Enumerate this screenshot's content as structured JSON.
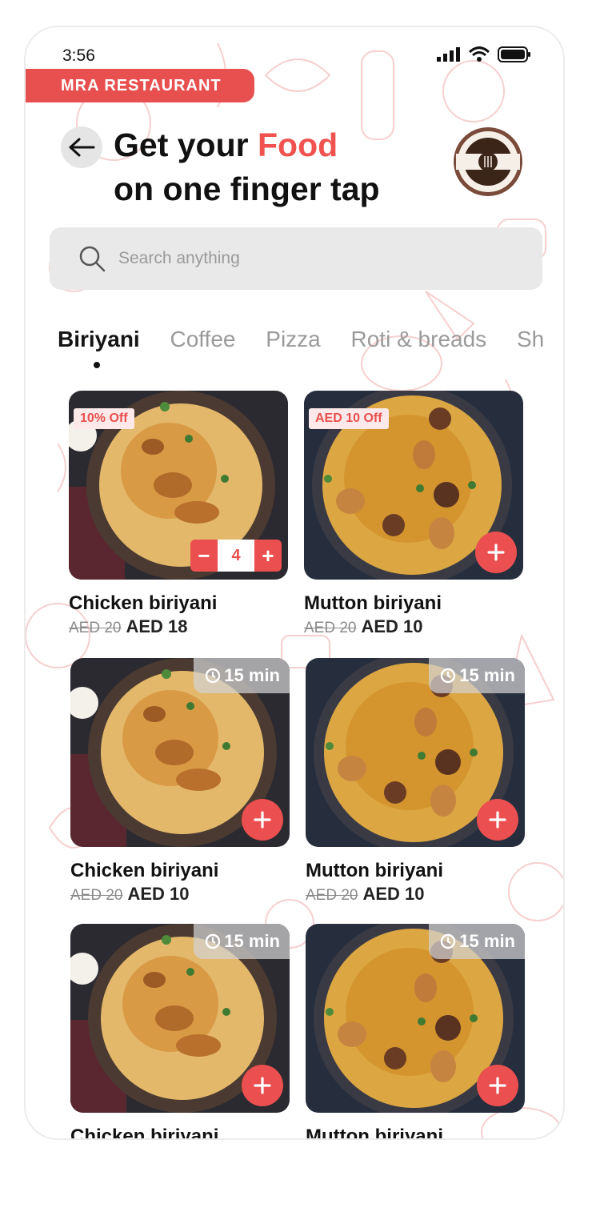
{
  "status": {
    "time": "3:56"
  },
  "brand": {
    "label": "MRA RESTAURANT"
  },
  "header": {
    "title_line1_prefix": "Get your ",
    "title_accent": "Food",
    "title_line2": "on one finger tap"
  },
  "search": {
    "placeholder": "Search anything"
  },
  "tabs": [
    {
      "label": "Biriyani",
      "active": true
    },
    {
      "label": "Coffee"
    },
    {
      "label": "Pizza"
    },
    {
      "label": "Roti &  breads"
    },
    {
      "label": "Sh"
    }
  ],
  "products": [
    {
      "name": "Chicken biriyani",
      "old_price": "AED 20",
      "price": "AED 18",
      "badge": "10% Off",
      "quantity": "4",
      "dish": "chicken"
    },
    {
      "name": "Mutton biriyani",
      "old_price": "AED 20",
      "price": "AED 10",
      "badge": "AED 10 Off",
      "dish": "mutton"
    },
    {
      "name": "Chicken biriyani",
      "old_price": "AED 20",
      "price": "AED 10",
      "time": "15 min",
      "dish": "chicken"
    },
    {
      "name": "Mutton biriyani",
      "old_price": "AED 20",
      "price": "AED 10",
      "time": "15 min",
      "dish": "mutton"
    },
    {
      "name": "Chicken biriyani",
      "time": "15 min",
      "dish": "chicken"
    },
    {
      "name": "Mutton biriyani",
      "time": "15 min",
      "dish": "mutton"
    }
  ],
  "colors": {
    "accent": "#f0524f",
    "brand": "#e8504f"
  }
}
